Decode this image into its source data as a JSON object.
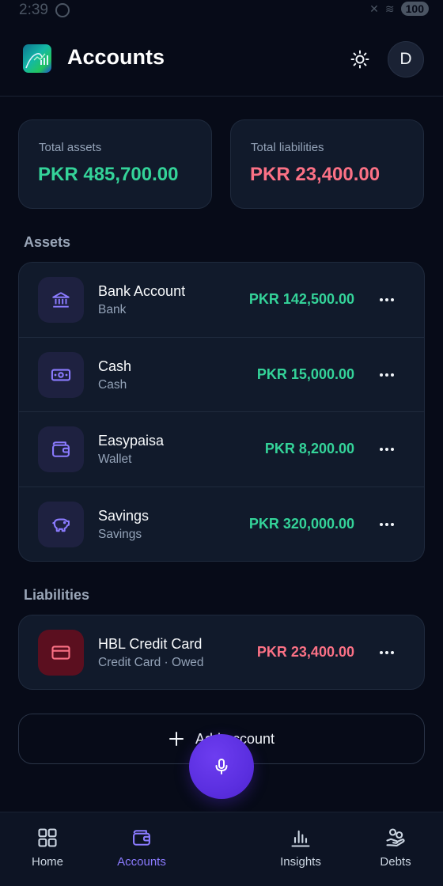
{
  "status_bar": {
    "time": "2:39",
    "battery": "100"
  },
  "header": {
    "title": "Accounts",
    "avatar_initial": "D"
  },
  "summary": {
    "assets_label": "Total assets",
    "assets_value": "PKR 485,700.00",
    "liabilities_label": "Total liabilities",
    "liabilities_value": "PKR 23,400.00"
  },
  "sections": {
    "assets_title": "Assets",
    "liabilities_title": "Liabilities"
  },
  "assets": [
    {
      "name": "Bank Account",
      "type": "Bank",
      "amount": "PKR 142,500.00",
      "icon": "bank-icon"
    },
    {
      "name": "Cash",
      "type": "Cash",
      "amount": "PKR 15,000.00",
      "icon": "cash-icon"
    },
    {
      "name": "Easypaisa",
      "type": "Wallet",
      "amount": "PKR 8,200.00",
      "icon": "wallet-icon"
    },
    {
      "name": "Savings",
      "type": "Savings",
      "amount": "PKR 320,000.00",
      "icon": "piggy-bank-icon"
    }
  ],
  "liabilities": [
    {
      "name": "HBL Credit Card",
      "type": "Credit Card · Owed",
      "amount": "PKR 23,400.00",
      "icon": "credit-card-icon"
    }
  ],
  "add_account_label": "Add account",
  "nav": {
    "home": "Home",
    "accounts": "Accounts",
    "insights": "Insights",
    "debts": "Debts"
  },
  "colors": {
    "positive": "#34d399",
    "negative": "#fb7185",
    "accent": "#8b7bff",
    "fab": "#5b2fe0"
  }
}
